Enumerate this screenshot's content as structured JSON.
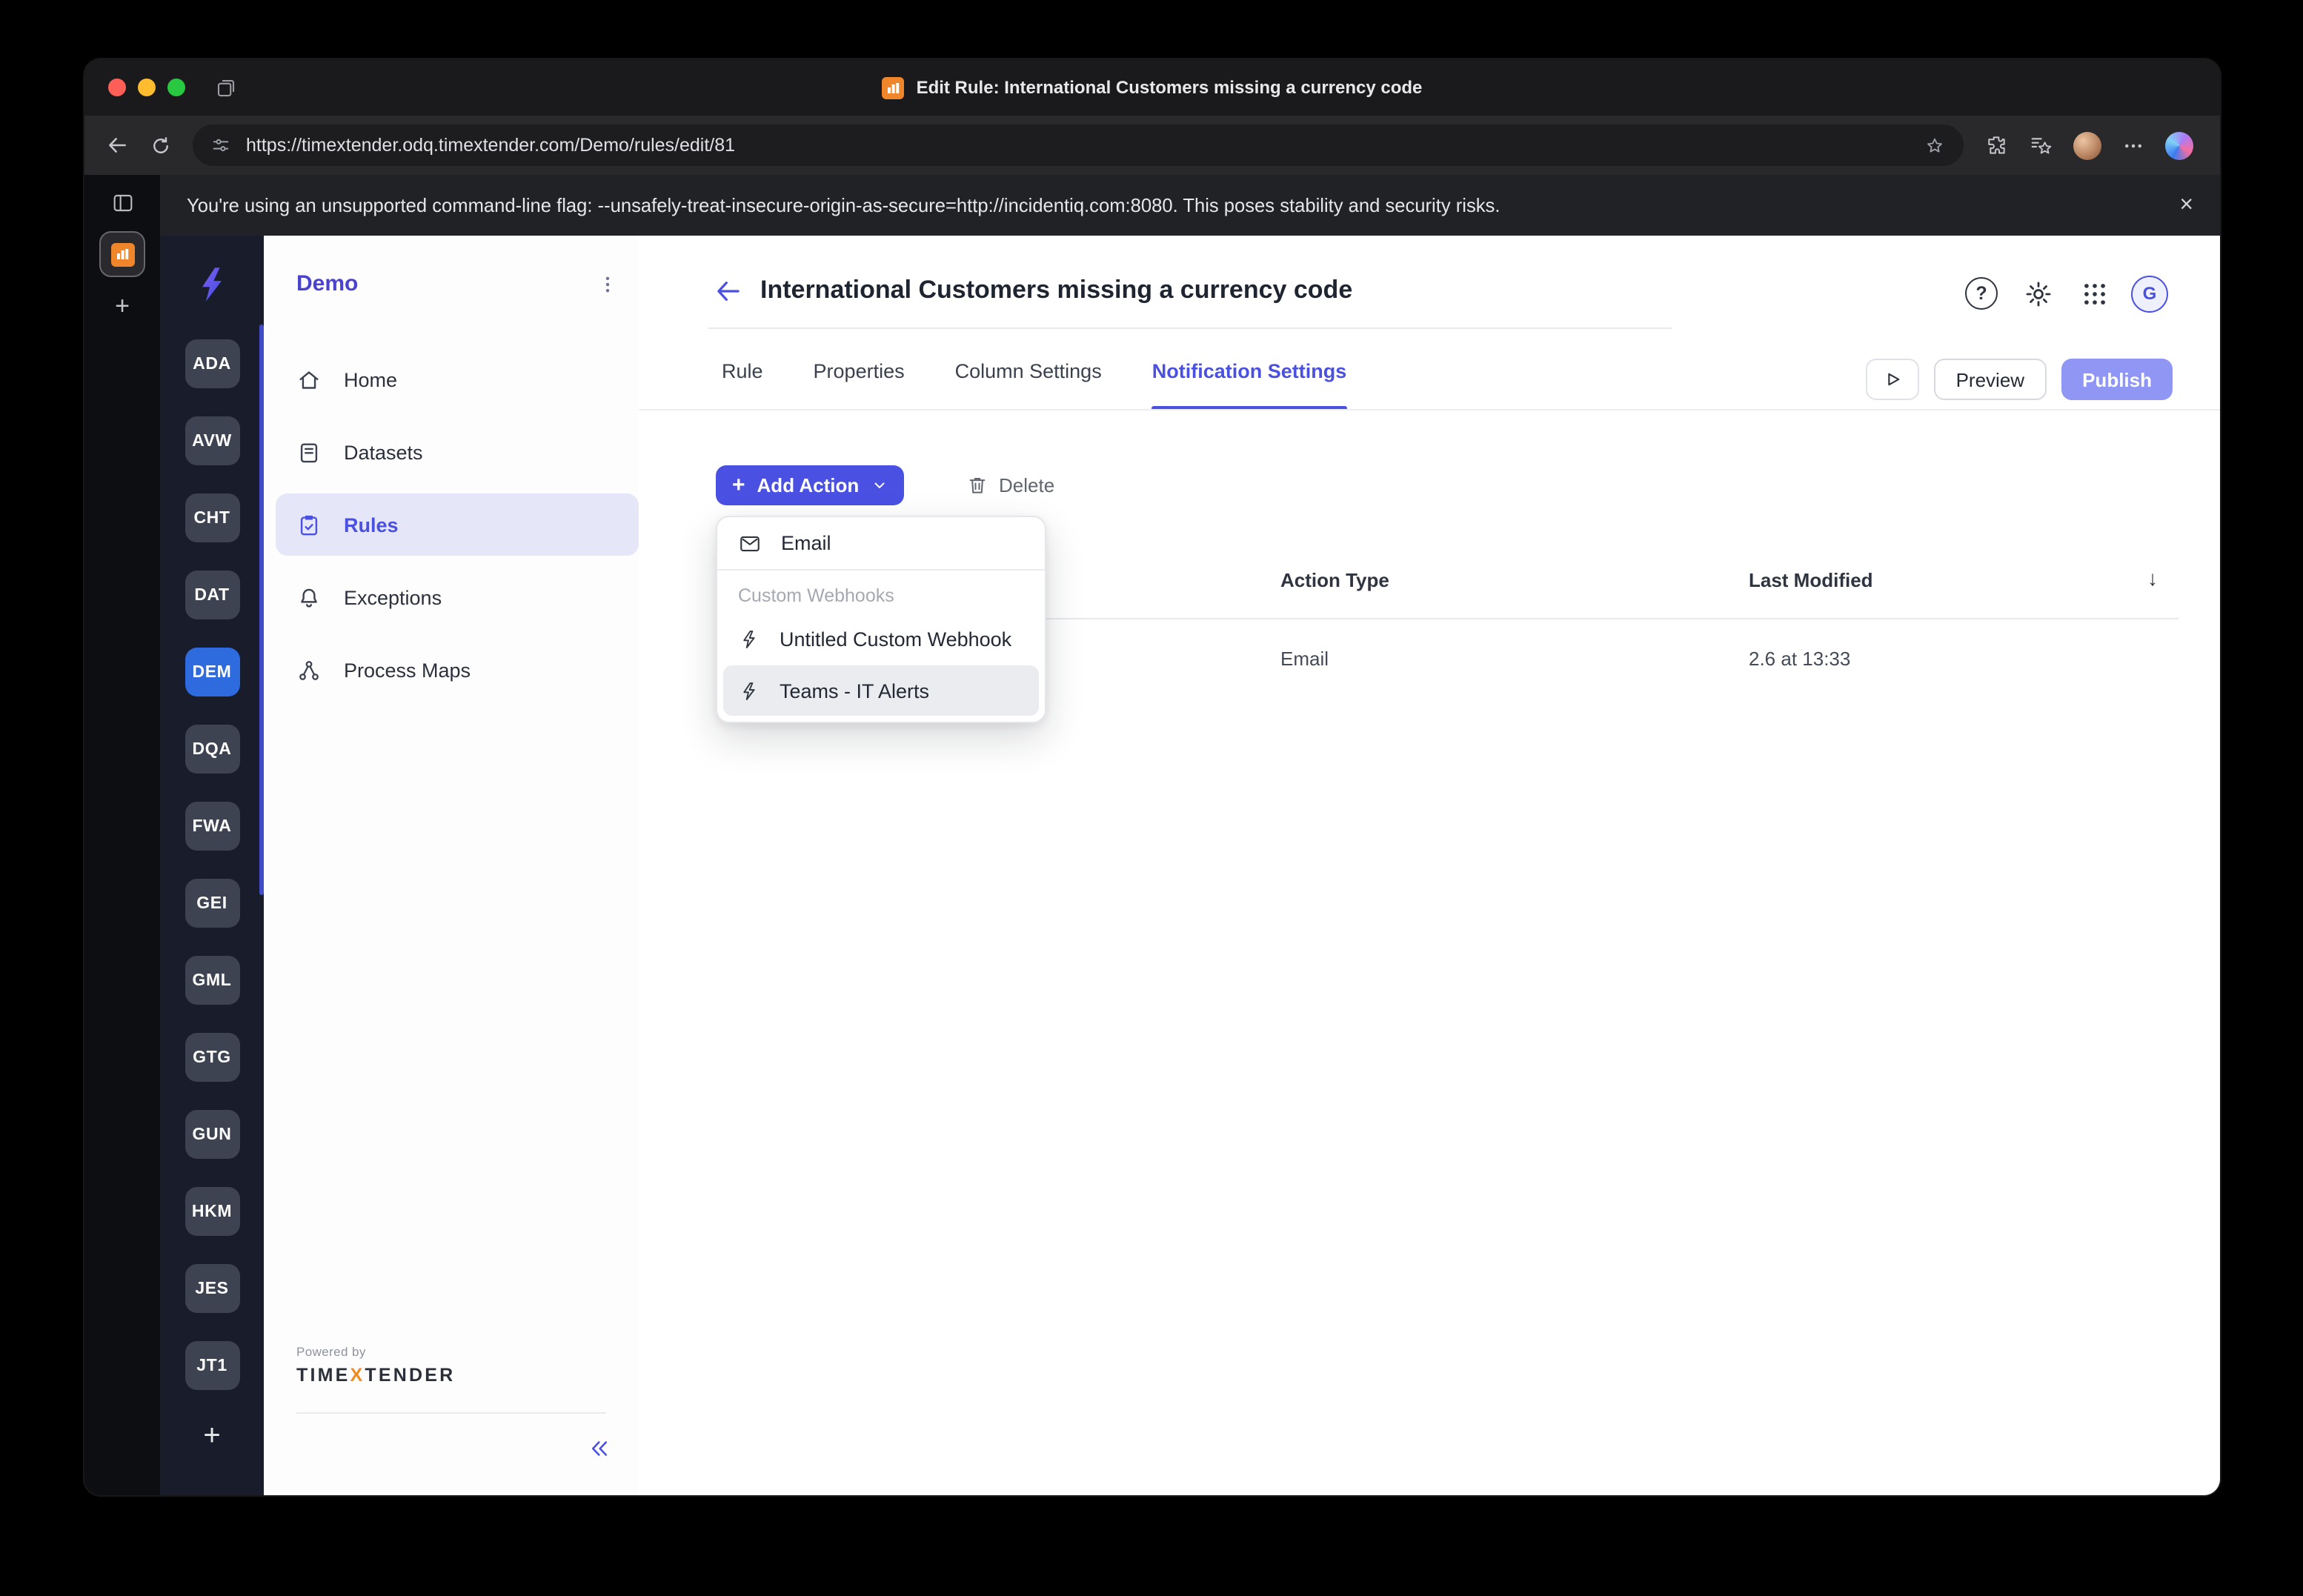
{
  "browser": {
    "tab_title": "Edit Rule: International Customers missing a currency code",
    "url": "https://timextender.odq.timextender.com/Demo/rules/edit/81",
    "warning": "You're using an unsupported command-line flag: --unsafely-treat-insecure-origin-as-secure=http://incidentiq.com:8080. This poses stability and security risks."
  },
  "glyphs": {
    "plus": "+",
    "close": "×",
    "sort_desc": "↓",
    "question": "?"
  },
  "rail": {
    "workspaces": [
      "ADA",
      "AVW",
      "CHT",
      "DAT",
      "DEM",
      "DQA",
      "FWA",
      "GEI",
      "GML",
      "GTG",
      "GUN",
      "HKM",
      "JES",
      "JT1"
    ],
    "active": "DEM"
  },
  "sidebar": {
    "title": "Demo",
    "items": [
      {
        "label": "Home"
      },
      {
        "label": "Datasets"
      },
      {
        "label": "Rules"
      },
      {
        "label": "Exceptions"
      },
      {
        "label": "Process Maps"
      }
    ],
    "active_item": "Rules",
    "powered_by": "Powered by",
    "brand": {
      "time": "TIME",
      "x": "X",
      "tender": "TENDER"
    }
  },
  "header": {
    "title": "International Customers missing a currency code",
    "avatar_initial": "G"
  },
  "tabs": [
    {
      "label": "Rule"
    },
    {
      "label": "Properties"
    },
    {
      "label": "Column Settings"
    },
    {
      "label": "Notification Settings"
    }
  ],
  "active_tab": "Notification Settings",
  "toolbar": {
    "preview": "Preview",
    "publish": "Publish",
    "add_action": "Add Action",
    "delete": "Delete"
  },
  "dropdown": {
    "email": "Email",
    "section": "Custom Webhooks",
    "options": [
      {
        "label": "Untitled Custom Webhook"
      },
      {
        "label": "Teams - IT Alerts"
      }
    ],
    "highlighted": "Teams - IT Alerts"
  },
  "table": {
    "headers": [
      "Action Type",
      "Last Modified"
    ],
    "rows": [
      {
        "action_type": "Email",
        "last_modified": "2.6 at 13:33"
      }
    ]
  },
  "colors": {
    "accent": "#4a50e2",
    "publish_button": "#8f96f3",
    "workspace_active": "#2e6bdf",
    "brand_orange": "#f08a1d"
  }
}
